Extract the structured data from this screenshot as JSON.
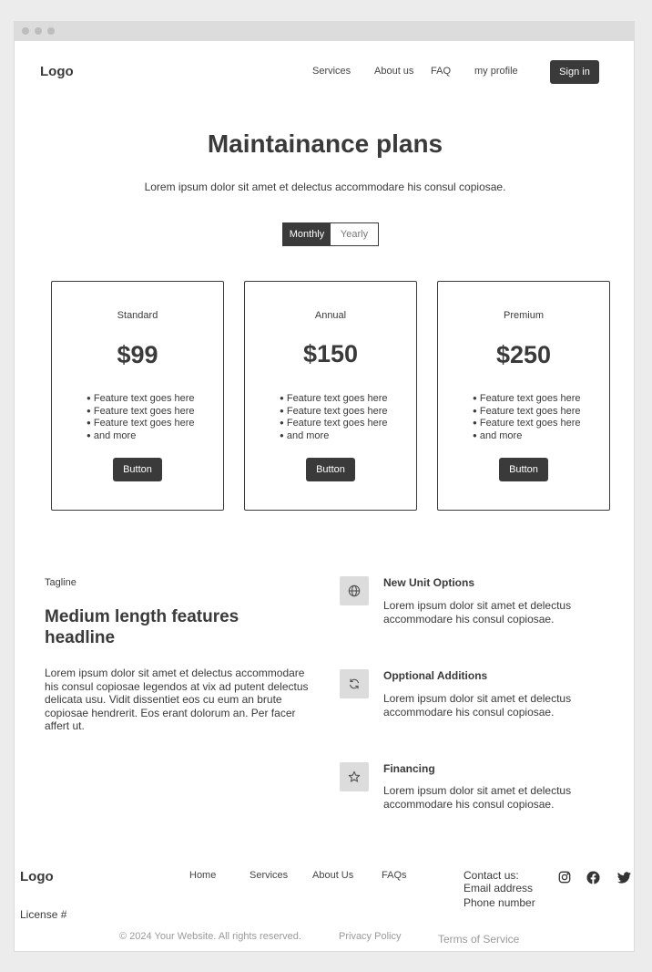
{
  "header": {
    "logo": "Logo",
    "nav": [
      "Services",
      "About us",
      "FAQ",
      "my profile"
    ],
    "signin_label": "Sign in"
  },
  "hero": {
    "title": "Maintainance plans",
    "subtitle": "Lorem ipsum dolor sit amet et delectus accommodare his consul copiosae.",
    "toggle": [
      "Monthly",
      "Yearly"
    ],
    "toggle_selected": "Monthly"
  },
  "plans": [
    {
      "name": "Standard",
      "price": "$99",
      "features": [
        "Feature text goes here",
        "Feature text goes here",
        "Feature text goes here",
        "and more"
      ],
      "button": "Button"
    },
    {
      "name": "Annual",
      "price": "$150",
      "features": [
        "Feature text goes here",
        "Feature text goes here",
        "Feature text goes here",
        "and more"
      ],
      "button": "Button"
    },
    {
      "name": "Premium",
      "price": "$250",
      "features": [
        "Feature text goes here",
        "Feature text goes here",
        "Feature text goes here",
        "and more"
      ],
      "button": "Button"
    }
  ],
  "features": {
    "tagline": "Tagline",
    "headline": "Medium length features headline",
    "body": "Lorem ipsum dolor sit amet et delectus accommodare his consul copiosae legendos at vix ad putent delectus delicata usu. Vidit dissentiet eos cu eum an brute copiosae hendrerit. Eos erant dolorum an. Per facer affert ut.",
    "items": [
      {
        "icon": "globe-icon",
        "title": "New Unit Options",
        "desc": "Lorem ipsum dolor sit amet et delectus accommodare his consul copiosae."
      },
      {
        "icon": "refresh-icon",
        "title": "Opptional Additions",
        "desc": "Lorem ipsum dolor sit amet et delectus accommodare his consul copiosae."
      },
      {
        "icon": "star-icon",
        "title": "Financing",
        "desc": "Lorem ipsum dolor sit amet et delectus accommodare his consul copiosae."
      }
    ]
  },
  "footer": {
    "logo": "Logo",
    "license": "License #",
    "links": [
      "Home",
      "Services",
      "About Us",
      "FAQs"
    ],
    "contact": [
      "Contact us:",
      "Email address",
      "Phone number"
    ],
    "social": [
      "instagram-icon",
      "facebook-icon",
      "twitter-icon"
    ],
    "copyright": "© 2024 Your Website. All rights reserved.",
    "privacy": "Privacy Policy",
    "terms": "Terms of Service"
  },
  "colors": {
    "dark": "#3a3a3a",
    "icon_bg": "#dcdcdc",
    "muted": "#9a9a9a",
    "page_bg": "#ececec"
  }
}
